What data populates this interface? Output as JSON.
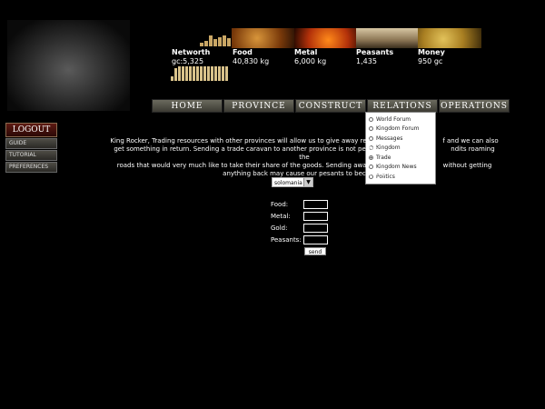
{
  "stats": [
    {
      "label": "Networth",
      "value": "gc:5,325"
    },
    {
      "label": "Food",
      "value": "40,830 kg"
    },
    {
      "label": "Metal",
      "value": "6,000 kg"
    },
    {
      "label": "Peasants",
      "value": "1,435"
    },
    {
      "label": "Money",
      "value": "950 gc"
    }
  ],
  "nav": [
    "HOME",
    "PROVINCE",
    "CONSTRUCT",
    "RELATIONS",
    "OPERATIONS"
  ],
  "dropdown": [
    "World Forum",
    "Kingdom Forum",
    "Messages",
    "Kingdom",
    "Trade",
    "Kingdom News",
    "Politics"
  ],
  "dropdown_selected": "Trade",
  "leftmenu": {
    "logout": "LOGOUT",
    "items": [
      "GUIDE",
      "TUTORIAL",
      "PREFERENCES"
    ]
  },
  "message": {
    "l1": "King Rocker, Trading resources with other provinces will allow us to give away res",
    "l1b": "f and we can also",
    "l2": "get something in return. Sending a trade caravan to another province is not perfec",
    "l2b": "ndits roaming the",
    "l3": "roads that would very much like to take their share of the goods. Sending away",
    "l3b": "without getting",
    "l4": "anything back may cause our pesants to become u"
  },
  "form": {
    "province": "solomania",
    "food_label": "Food:",
    "metal_label": "Metal:",
    "gold_label": "Gold:",
    "peasants_label": "Peasants:",
    "send_label": "send"
  }
}
